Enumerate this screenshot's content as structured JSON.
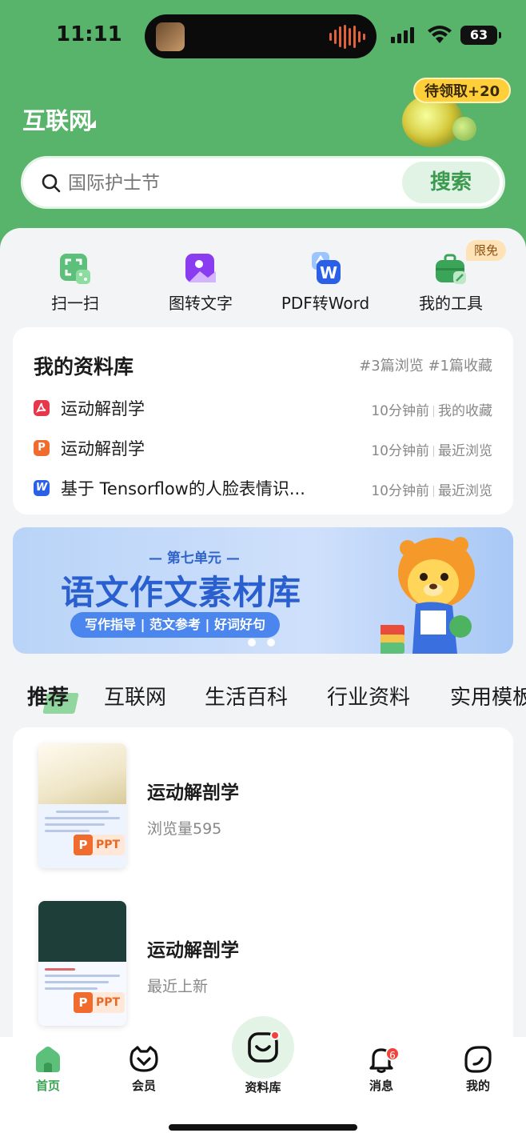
{
  "status_bar": {
    "time": "11:11",
    "battery": "63"
  },
  "header": {
    "region": "互联网",
    "reward_badge": "待领取+20"
  },
  "search": {
    "placeholder": "国际护士节",
    "button_label": "搜索"
  },
  "tools": [
    {
      "label": "扫一扫",
      "icon": "scan-icon"
    },
    {
      "label": "图转文字",
      "icon": "image-to-text-icon"
    },
    {
      "label": "PDF转Word",
      "icon": "pdf-to-word-icon"
    },
    {
      "label": "我的工具",
      "icon": "toolbox-icon"
    }
  ],
  "tools_free_tag": "限免",
  "library": {
    "title": "我的资料库",
    "stats": "#3篇浏览 #1篇收藏",
    "items": [
      {
        "type": "pdf",
        "name": "运动解剖学",
        "time": "10分钟前",
        "source": "我的收藏"
      },
      {
        "type": "ppt",
        "name": "运动解剖学",
        "time": "10分钟前",
        "source": "最近浏览"
      },
      {
        "type": "word",
        "name": "基于 Tensorflow的人脸表情识...",
        "time": "10分钟前",
        "source": "最近浏览"
      }
    ]
  },
  "banner": {
    "subtitle": "— 第七单元 —",
    "title": "语文作文素材库",
    "chip": "写作指导 | 范文参考 | 好词好句"
  },
  "category_tabs": [
    "推荐",
    "互联网",
    "生活百科",
    "行业资料",
    "实用模板"
  ],
  "active_tab": "推荐",
  "feed": [
    {
      "title": "运动解剖学",
      "meta": "浏览量595",
      "badge": "PPT"
    },
    {
      "title": "运动解剖学",
      "meta": "最近上新",
      "badge": "PPT"
    }
  ],
  "bottom_nav": [
    {
      "label": "首页",
      "icon": "home-icon",
      "active": true
    },
    {
      "label": "会员",
      "icon": "vip-icon",
      "active": false
    },
    {
      "label": "资料库",
      "icon": "library-icon",
      "active": false
    },
    {
      "label": "消息",
      "icon": "bell-icon",
      "active": false,
      "badge": "6"
    },
    {
      "label": "我的",
      "icon": "profile-icon",
      "active": false
    }
  ],
  "colors": {
    "brand_green": "#58b46a",
    "active_green": "#3ba655",
    "badge_red": "#f2433b",
    "banner_blue": "#2a5fd0"
  }
}
